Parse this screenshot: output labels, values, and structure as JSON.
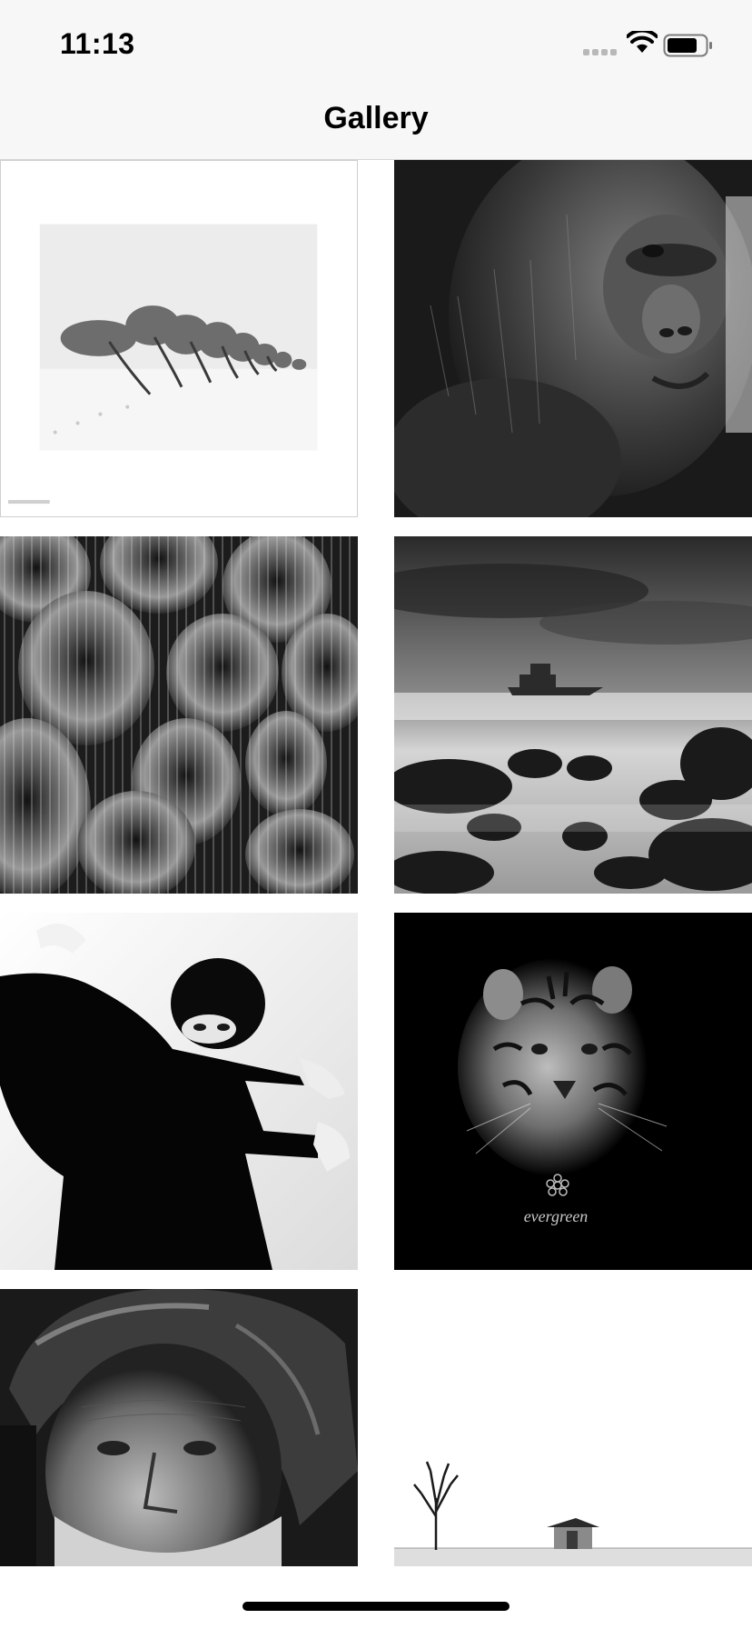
{
  "status_bar": {
    "time": "11:13",
    "icons": [
      "signal-icon",
      "wifi-icon",
      "battery-icon"
    ]
  },
  "nav": {
    "title": "Gallery"
  },
  "gallery": {
    "photos": [
      {
        "subject": "windswept-trees-snow",
        "caption": ""
      },
      {
        "subject": "gorilla-portrait",
        "caption": ""
      },
      {
        "subject": "barrel-cacti",
        "caption": ""
      },
      {
        "subject": "shipwreck-seascape",
        "caption": ""
      },
      {
        "subject": "woman-black-sweater",
        "caption": ""
      },
      {
        "subject": "tiger-portrait",
        "caption": "evergreen"
      },
      {
        "subject": "old-man-helmet",
        "caption": ""
      },
      {
        "subject": "tree-and-hut-minimal",
        "caption": ""
      }
    ]
  },
  "colors": {
    "bar_background": "#f7f7f7",
    "page_background": "#ffffff",
    "text": "#000000"
  }
}
